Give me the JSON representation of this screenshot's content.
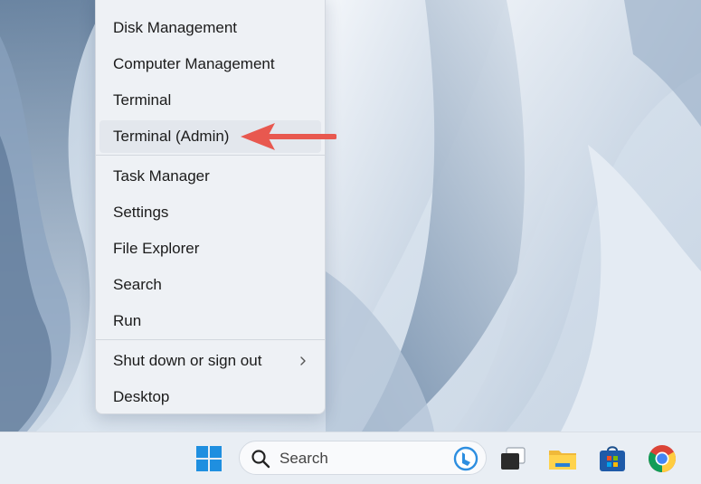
{
  "context_menu": {
    "items": [
      {
        "label": "Disk Management"
      },
      {
        "label": "Computer Management"
      },
      {
        "label": "Terminal"
      },
      {
        "label": "Terminal (Admin)"
      },
      {
        "label": "Task Manager"
      },
      {
        "label": "Settings"
      },
      {
        "label": "File Explorer"
      },
      {
        "label": "Search"
      },
      {
        "label": "Run"
      },
      {
        "label": "Shut down or sign out"
      },
      {
        "label": "Desktop"
      }
    ],
    "highlighted_item": "Terminal (Admin)"
  },
  "annotation": {
    "arrow_color": "#e8584f",
    "points_to": "Terminal (Admin)"
  },
  "taskbar": {
    "search_placeholder": "Search",
    "icons": [
      "windows-start-icon",
      "search-icon",
      "bing-icon",
      "task-view-icon",
      "file-explorer-icon",
      "microsoft-store-icon",
      "chrome-icon"
    ]
  },
  "colors": {
    "windows_blue": "#1f8fe0",
    "menu_bg": "#eef1f5",
    "taskbar_bg": "#e9eef4"
  }
}
